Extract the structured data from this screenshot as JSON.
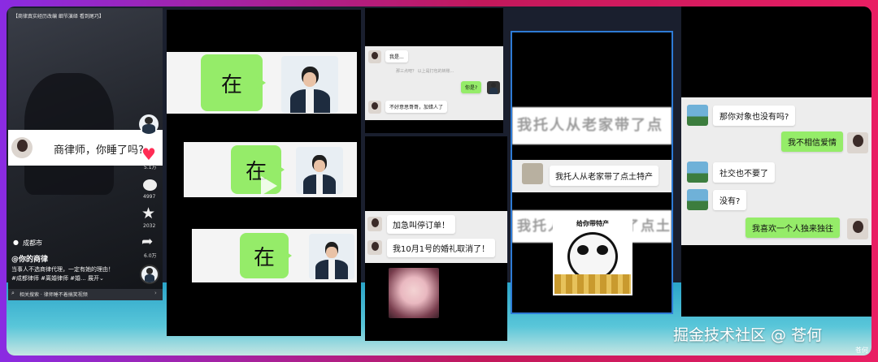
{
  "panel1": {
    "top_text": "【商律真实经历改编 细节演绎 看到尾巧】",
    "subtitle": "商律师，你睡了吗?",
    "like_count": "5.1万",
    "comment_count": "4997",
    "fav_count": "2032",
    "share_count": "6.0万",
    "location": "成都市",
    "author": "@你的商律",
    "description": "当事人不选商律代理，一定有她的理由！",
    "hashtags": "#成都律师 #离婚律师 #婚... 展开⌄",
    "search_text": "相关搜索 · 律师睡不着搞笑视频"
  },
  "panel2": {
    "bubble1": "在",
    "bubble2": "在",
    "bubble3": "在"
  },
  "panel3": {
    "msg1": "我是...",
    "msg2": "那三点吧？  以上是打包的转账...",
    "msg3": "你是?",
    "msg4": "不好意思哥哥，加错人了"
  },
  "panel4": {
    "msg1": "加急叫停订单！",
    "msg2": "我10月1号的婚礼取消了！"
  },
  "panel5": {
    "blur1": "我托人从老家带了点",
    "msg1": "我托人从老家带了点土特产",
    "blur2": "我托人从老家带了点土特",
    "meme_caption": "给你带特产"
  },
  "panel6": {
    "msg1": "那你对象也没有吗?",
    "msg2": "我不相信爱情",
    "msg3": "社交也不要了",
    "msg4": "没有?",
    "msg5": "我喜欢一个人独来独往"
  },
  "watermark": {
    "main": "掘金技术社区 @ 苍何",
    "small": "苍何"
  },
  "colors": {
    "bubble_green": "#95ec69",
    "like_red": "#ff2d55",
    "background_gradient": [
      "#8a2be2",
      "#e91e63"
    ]
  }
}
